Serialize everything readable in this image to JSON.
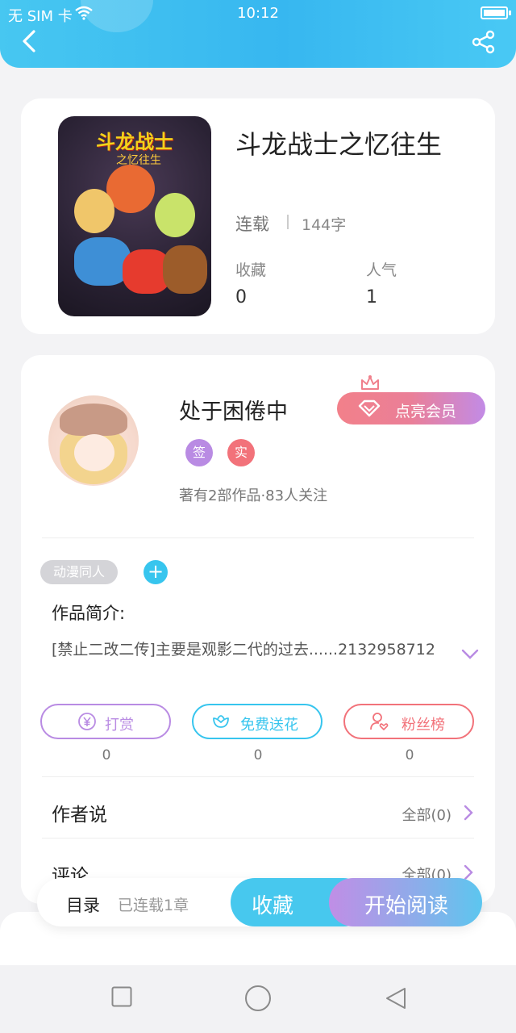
{
  "status_bar": {
    "carrier": "无 SIM 卡",
    "time": "10:12",
    "battery_level": 1.0
  },
  "header": {
    "back_icon": "chevron-left-icon",
    "share_icon": "share-icon",
    "color": "#3ab9f1"
  },
  "book": {
    "cover_title": "斗龙战士",
    "cover_subtitle": "之忆往生",
    "title": "斗龙战士之忆往生",
    "status": "连载",
    "word_count": "144字",
    "stats": [
      {
        "label": "收藏",
        "value": "0"
      },
      {
        "label": "人气",
        "value": "1"
      }
    ]
  },
  "author": {
    "name": "处于困倦中",
    "vip_button": "点亮会员",
    "badges": [
      {
        "label": "签",
        "color": "#b98be3"
      },
      {
        "label": "实",
        "color": "#f2727a"
      }
    ],
    "meta": "著有2部作品·83人关注"
  },
  "work": {
    "tag": "动漫同人",
    "add_tag_icon": "+",
    "intro_label": "作品简介:",
    "intro_text": "[禁止二改二传]主要是观影二代的过去......2132958712"
  },
  "actions": [
    {
      "label": "打赏",
      "icon": "yen-icon",
      "color": "#b98be3",
      "count": "0"
    },
    {
      "label": "免费送花",
      "icon": "flower-icon",
      "color": "#37c5ee",
      "count": "0"
    },
    {
      "label": "粉丝榜",
      "icon": "fans-icon",
      "color": "#f2727a",
      "count": "0"
    }
  ],
  "sections": [
    {
      "title": "作者说",
      "more": "全部(0)"
    },
    {
      "title": "评论",
      "more": "全部(0)"
    }
  ],
  "bottom_bar": {
    "toc_label": "目录",
    "toc_status": "已连载1章",
    "favorite_label": "收藏",
    "read_label": "开始阅读"
  },
  "system_nav": [
    "square-icon",
    "circle-icon",
    "triangle-back-icon"
  ]
}
